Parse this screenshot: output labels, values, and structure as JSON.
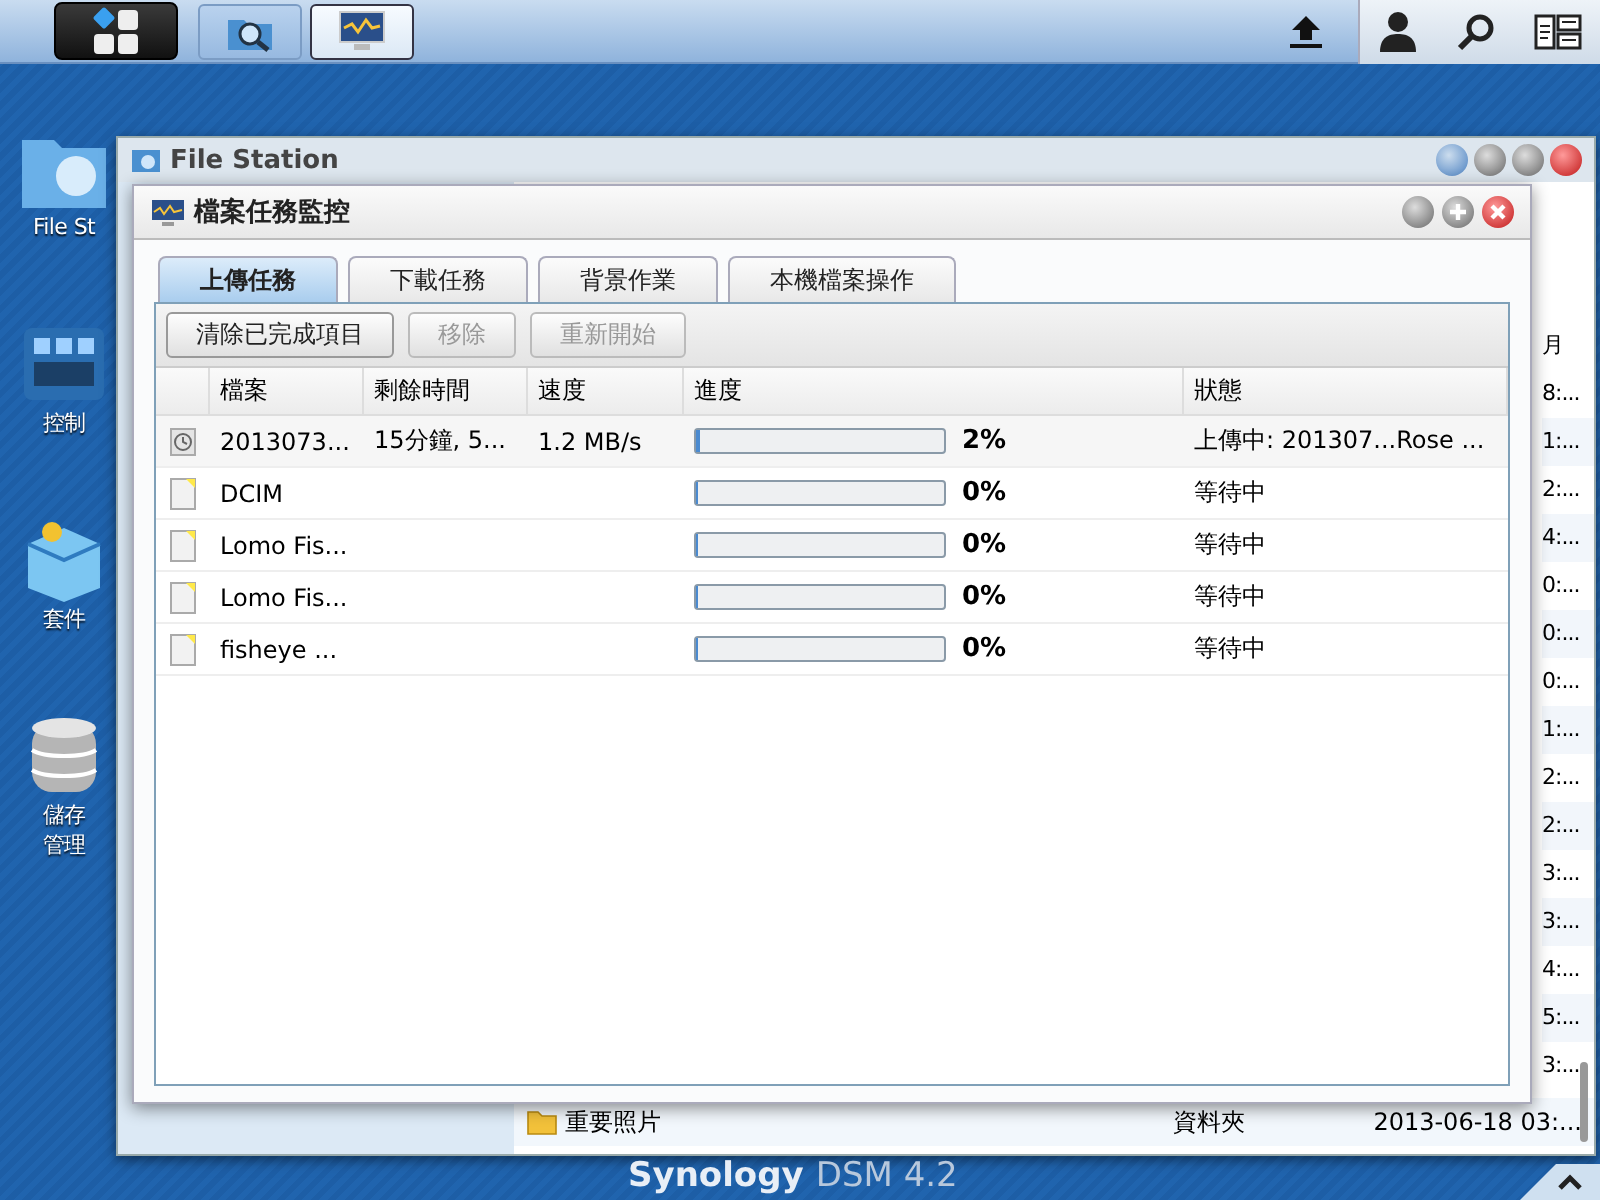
{
  "taskbar": {
    "apps": [
      {
        "kind": "search-folder",
        "selected": false
      },
      {
        "kind": "monitor",
        "selected": true
      }
    ]
  },
  "desktop_icons": [
    {
      "kind": "folder",
      "lines": [
        "File St"
      ]
    },
    {
      "kind": "control",
      "lines": [
        "控制"
      ]
    },
    {
      "kind": "package",
      "lines": [
        "套件"
      ]
    },
    {
      "kind": "storage",
      "lines": [
        "儲存",
        "管理"
      ]
    }
  ],
  "background_window": {
    "title": "File Station",
    "column_header": "月",
    "times": [
      "8:...",
      "1:...",
      "2:...",
      "4:...",
      "0:...",
      "0:...",
      "0:...",
      "1:...",
      "2:...",
      "2:...",
      "3:...",
      "3:...",
      "4:...",
      "5:...",
      "3:..."
    ],
    "last_row": {
      "name": "重要照片",
      "type": "資料夾",
      "date": "2013-06-18 03:..."
    }
  },
  "dialog": {
    "title": "檔案任務監控",
    "tabs": [
      {
        "label": "上傳任務",
        "selected": true
      },
      {
        "label": "下載任務",
        "selected": false
      },
      {
        "label": "背景作業",
        "selected": false
      },
      {
        "label": "本機檔案操作",
        "selected": false
      }
    ],
    "buttons": [
      {
        "label": "清除已完成項目",
        "disabled": false
      },
      {
        "label": "移除",
        "disabled": true
      },
      {
        "label": "重新開始",
        "disabled": true
      }
    ],
    "columns": [
      "檔案",
      "剩餘時間",
      "速度",
      "進度",
      "狀態"
    ],
    "rows": [
      {
        "kind": "active",
        "file": "2013073...",
        "remaining": "15分鐘, 5...",
        "speed": "1.2 MB/s",
        "level": 0.02,
        "percent": "2%",
        "status": "上傳中: 201307...Rose ..."
      },
      {
        "kind": "waiting",
        "file": "DCIM",
        "level": 0,
        "percent": "0%",
        "status": "等待中"
      },
      {
        "kind": "waiting",
        "file": "Lomo Fis...",
        "level": 0,
        "percent": "0%",
        "status": "等待中"
      },
      {
        "kind": "waiting",
        "file": "Lomo Fis...",
        "level": 0,
        "percent": "0%",
        "status": "等待中"
      },
      {
        "kind": "waiting",
        "file": "fisheye ...",
        "level": 0,
        "percent": "0%",
        "status": "等待中"
      }
    ]
  },
  "brand": {
    "name": "Synology",
    "version": "DSM 4.2"
  }
}
